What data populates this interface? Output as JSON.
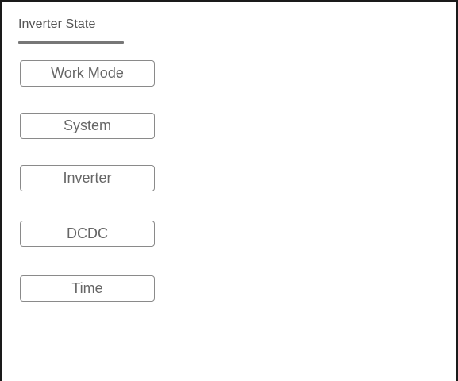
{
  "tab": {
    "label": "Inverter State"
  },
  "buttons": [
    {
      "label": "Work Mode"
    },
    {
      "label": "System"
    },
    {
      "label": "Inverter"
    },
    {
      "label": "DCDC"
    },
    {
      "label": "Time"
    }
  ]
}
